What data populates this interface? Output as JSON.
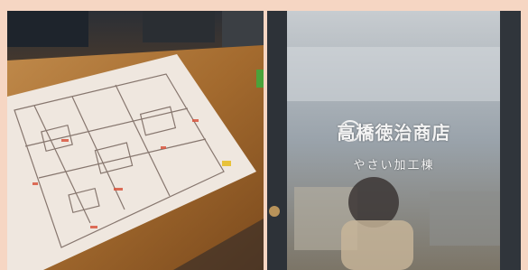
{
  "left_photo": {
    "subject": "floor-plan-on-table"
  },
  "right_photo": {
    "subject": "glass-door-with-sign",
    "sign_main_text": "高橋徳治商店",
    "sign_sub_text": "やさい加工棟"
  },
  "colors": {
    "border": "#f6d6c3",
    "table_wood": "#a86a2e",
    "paper": "#f1e9e2",
    "door_frame": "#2d3238"
  }
}
